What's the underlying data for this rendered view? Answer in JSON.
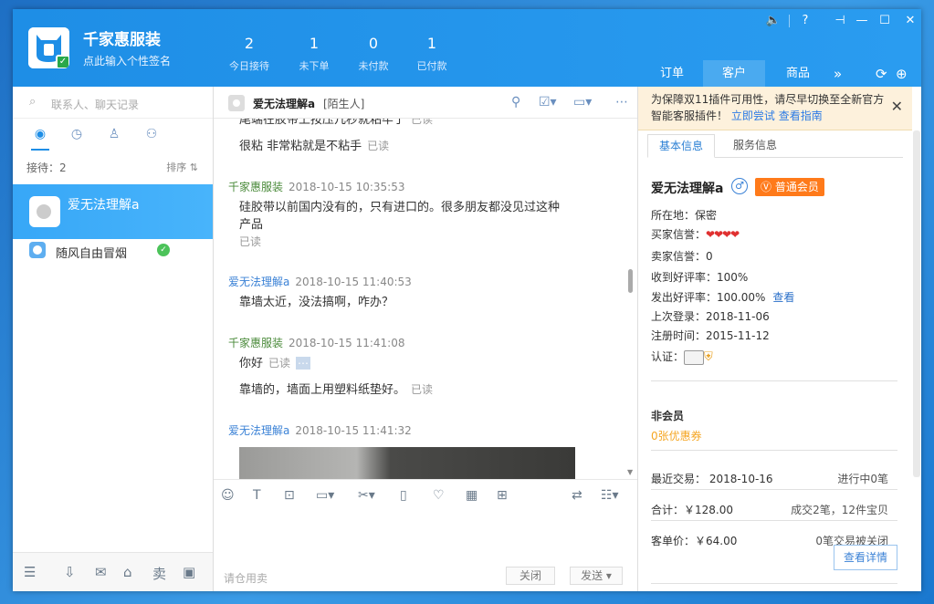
{
  "app": {
    "shop_name": "千家惠服装",
    "signature": "点此输入个性签名",
    "stats": [
      {
        "value": "2",
        "label": "今日接待"
      },
      {
        "value": "1",
        "label": "未下单"
      },
      {
        "value": "0",
        "label": "未付款"
      },
      {
        "value": "1",
        "label": "已付款"
      }
    ],
    "tabs": [
      "订单",
      "客户",
      "商品"
    ],
    "active_tab": "客户"
  },
  "left": {
    "search_placeholder": "联系人、聊天记录",
    "receiving": "接待：2",
    "sort": "排序 ⇅",
    "contacts": [
      {
        "name": "爱无法理解a"
      },
      {
        "name": "随风自由冒烟"
      }
    ],
    "bottom_icons": [
      "menu-icon",
      "download-icon",
      "mail-icon",
      "store-icon",
      "sell-icon",
      "window-icon"
    ],
    "sell_label": "卖"
  },
  "chat": {
    "contact_name": "爱无法理解a",
    "contact_tag": "[陌生人]",
    "messages": [
      {
        "text": "尾端在胶带上按压几秒就粘牢了",
        "read": "已读"
      },
      {
        "text": "很粘 非常粘就是不粘手",
        "read": "已读"
      },
      {
        "sender": "千家惠服装",
        "time": "2018-10-15 10:35:53"
      },
      {
        "text1": "硅胶带以前国内没有的，只有进口的。很多朋友都没见过这种",
        "text2": "产品",
        "read": "已读"
      },
      {
        "sender": "爱无法理解a",
        "time": "2018-10-15 11:40:53"
      },
      {
        "text": "靠墙太近，没法搞啊，咋办？"
      },
      {
        "sender": "千家惠服装",
        "time": "2018-10-15 11:41:08"
      },
      {
        "text": "你好",
        "read": "已读"
      },
      {
        "text": "靠墙的，墙面上用塑料纸垫好。",
        "read": "已读"
      },
      {
        "sender": "爱无法理解a",
        "time": "2018-10-15 11:41:32"
      }
    ],
    "input_placeholder": "请仓用卖",
    "close_label": "关闭",
    "send_label": "发送"
  },
  "right": {
    "notice_text": "为保障双11插件可用性，请尽早切换至全新官方智能客服插件！",
    "notice_link1": "立即尝试",
    "notice_link2": "查看指南",
    "tab_basic": "基本信息",
    "tab_service": "服务信息",
    "name": "爱无法理解a",
    "member_level": "普通会员",
    "location": "所在地：保密",
    "buyer_credit": "买家信誉：",
    "seller_credit": "卖家信誉：0",
    "recv_good": "收到好评率：100%",
    "sent_good": "发出好评率：100.00%",
    "view_link": "查看",
    "last_login": "上次登录：2018-11-06",
    "reg_time": "注册时间：2015-11-12",
    "cert": "认证：",
    "non_member": "非会员",
    "coupons": "0张优惠券",
    "recent_trade": "最近交易：  2018-10-16",
    "in_progress": "进行中0笔",
    "total": "合计：￥128.00",
    "deals": "成交2笔，12件宝贝",
    "avg_price": "客单价：￥64.00",
    "closed": "0笔交易被关闭",
    "detail_button": "查看详情"
  }
}
